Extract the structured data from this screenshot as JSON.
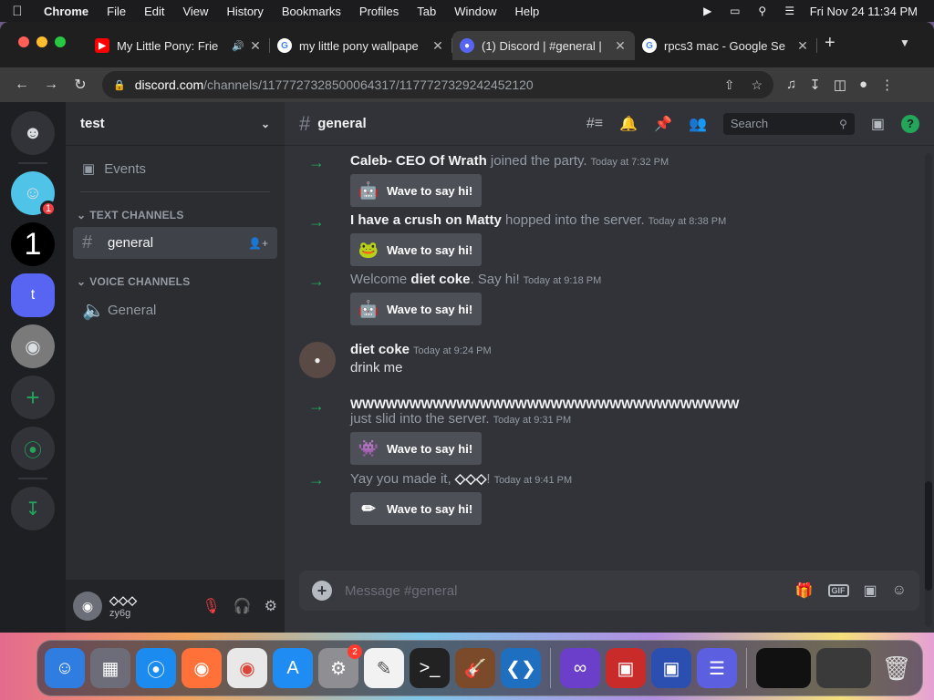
{
  "menubar": {
    "app": "Chrome",
    "items": [
      "File",
      "Edit",
      "View",
      "History",
      "Bookmarks",
      "Profiles",
      "Tab",
      "Window",
      "Help"
    ],
    "clock": "Fri Nov 24  11:34 PM"
  },
  "browser": {
    "tabs": [
      {
        "title": "My Little Pony: Frie",
        "favicon": "youtube-icon"
      },
      {
        "title": "my little pony wallpape",
        "favicon": "google-icon"
      },
      {
        "title": "(1) Discord | #general |",
        "favicon": "discord-icon"
      },
      {
        "title": "rpcs3 mac - Google Se",
        "favicon": "google-icon"
      }
    ],
    "url_host": "discord.com",
    "url_path": "/channels/1177727328500064317/1177727329242452120"
  },
  "guilds": {
    "dm_badge": "1",
    "one_label": "1",
    "active_label": "t"
  },
  "sidebar": {
    "server_name": "test",
    "events_label": "Events",
    "text_category": "TEXT CHANNELS",
    "text_channel": "general",
    "voice_category": "VOICE CHANNELS",
    "voice_channel": "General"
  },
  "user": {
    "name": "◇◇◇",
    "tag": "zy6g"
  },
  "channel": {
    "name": "general",
    "search_placeholder": "Search"
  },
  "messages": {
    "m1": {
      "name": "Caleb- CEO Of Wrath",
      "action": " joined the party.",
      "time": "Today at 7:32 PM"
    },
    "m2": {
      "name": "I have a crush on Matty",
      "action": " hopped into the server.",
      "time": "Today at 8:38 PM"
    },
    "m3": {
      "prefix": "Welcome ",
      "name": "diet coke",
      "action": ". Say hi!",
      "time": "Today at 9:18 PM"
    },
    "m4": {
      "author": "diet coke",
      "time": "Today at 9:24 PM",
      "text": "drink me"
    },
    "m5": {
      "name": "WWWWWWWWWWWWWWWWWWWWWWWWWWWWWWWWW",
      "action": "just slid into the server.",
      "time": "Today at 9:31 PM"
    },
    "m6": {
      "prefix": "Yay you made it, ",
      "name": "◇◇◇",
      "action": "!",
      "time": "Today at 9:41 PM"
    },
    "wave_label": "Wave to say hi!"
  },
  "composer": {
    "placeholder": "Message #general",
    "gif_label": "GIF"
  },
  "dock": {
    "settings_badge": "2"
  }
}
